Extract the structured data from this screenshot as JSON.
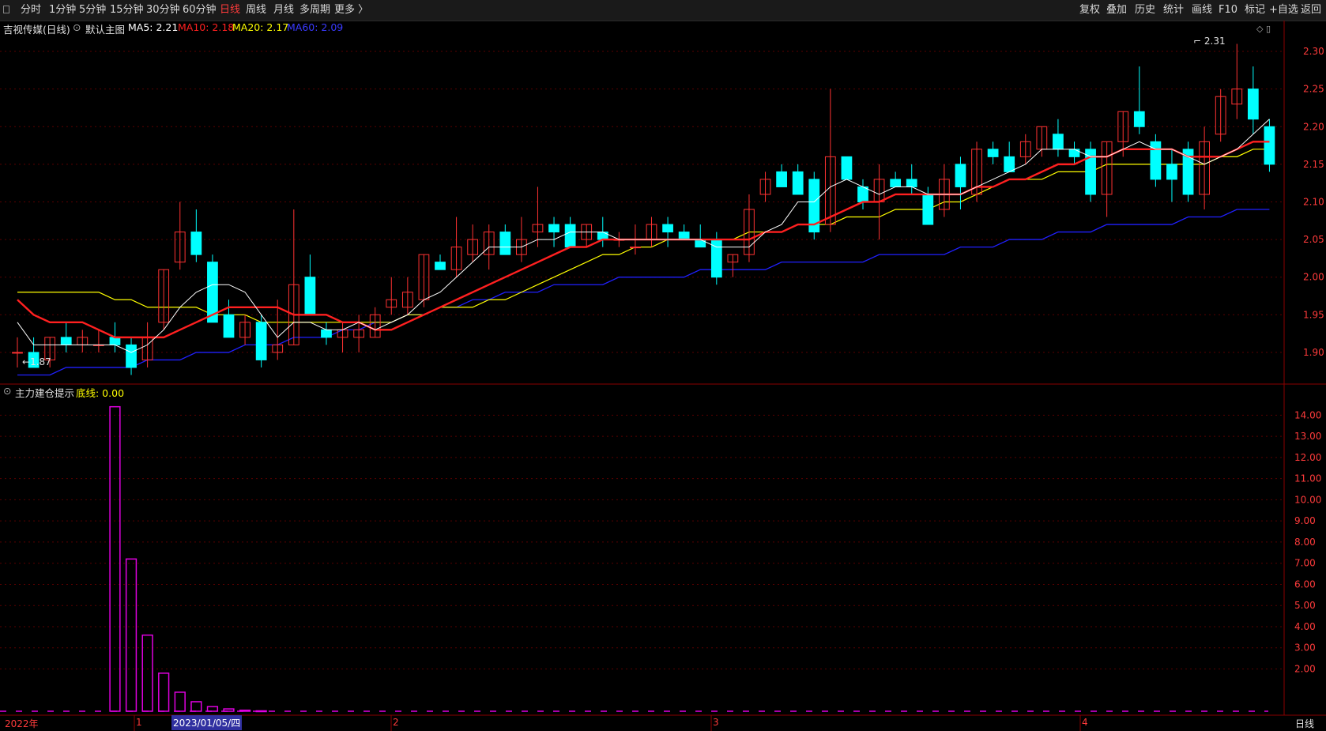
{
  "toolbar": {
    "periods": [
      "分时",
      "1分钟",
      "5分钟",
      "15分钟",
      "30分钟",
      "60分钟",
      "日线",
      "周线",
      "月线",
      "多周期",
      "更多 〉"
    ],
    "active_period": "日线",
    "right_buttons": [
      "复权",
      "叠加",
      "历史",
      "统计",
      "画线",
      "F10",
      "标记",
      "+自选",
      "返回"
    ]
  },
  "main_info": {
    "stock": "吉视传媒(日线)",
    "template": "默认主图",
    "ma5": "MA5: 2.21",
    "ma10": "MA10: 2.18",
    "ma20": "MA20: 2.17",
    "ma60": "MA60: 2.09"
  },
  "indicator_info": {
    "name": "主力建仓提示",
    "line": "底线: 0.00"
  },
  "bottom": {
    "year_label": "2022年",
    "months": [
      "1",
      "2",
      "3",
      "4"
    ],
    "date_cursor": "2023/01/05/四",
    "period": "日线"
  },
  "annotations": {
    "low": "1.87",
    "high": "2.31"
  },
  "colors": {
    "bg": "#000000",
    "up": "#ff3232",
    "down": "#00ffff",
    "ma5": "#ffffff",
    "ma10": "#ff2020",
    "ma20": "#ffff00",
    "ma60": "#2020ff",
    "grid": "#5a0000",
    "indicator": "#e000e0"
  },
  "chart_data": [
    {
      "type": "candlestick",
      "title": "吉视传媒(日线)",
      "ylim": [
        1.86,
        2.32
      ],
      "y_ticks": [
        1.9,
        1.95,
        2.0,
        2.05,
        2.1,
        2.15,
        2.2,
        2.25,
        2.3
      ],
      "candles": [
        [
          1.9,
          1.92,
          1.88,
          1.9
        ],
        [
          1.9,
          1.92,
          1.88,
          1.88
        ],
        [
          1.89,
          1.92,
          1.88,
          1.92
        ],
        [
          1.92,
          1.94,
          1.9,
          1.91
        ],
        [
          1.91,
          1.93,
          1.9,
          1.92
        ],
        [
          1.91,
          1.93,
          1.9,
          1.91
        ],
        [
          1.92,
          1.94,
          1.9,
          1.91
        ],
        [
          1.91,
          1.92,
          1.87,
          1.88
        ],
        [
          1.89,
          1.94,
          1.88,
          1.92
        ],
        [
          1.94,
          2.01,
          1.93,
          2.01
        ],
        [
          2.02,
          2.1,
          2.01,
          2.06
        ],
        [
          2.06,
          2.09,
          2.02,
          2.03
        ],
        [
          2.02,
          2.03,
          1.94,
          1.94
        ],
        [
          1.95,
          1.97,
          1.92,
          1.92
        ],
        [
          1.92,
          1.95,
          1.91,
          1.94
        ],
        [
          1.94,
          1.95,
          1.88,
          1.89
        ],
        [
          1.9,
          1.97,
          1.89,
          1.91
        ],
        [
          1.91,
          2.09,
          1.91,
          1.99
        ],
        [
          2.0,
          2.03,
          1.95,
          1.95
        ],
        [
          1.93,
          1.94,
          1.91,
          1.92
        ],
        [
          1.92,
          1.94,
          1.9,
          1.93
        ],
        [
          1.92,
          1.95,
          1.9,
          1.93
        ],
        [
          1.92,
          1.96,
          1.92,
          1.95
        ],
        [
          1.96,
          2.0,
          1.95,
          1.97
        ],
        [
          1.96,
          2.0,
          1.95,
          1.98
        ],
        [
          1.97,
          2.03,
          1.96,
          2.03
        ],
        [
          2.02,
          2.03,
          2.01,
          2.01
        ],
        [
          2.01,
          2.08,
          2.0,
          2.04
        ],
        [
          2.03,
          2.07,
          2.02,
          2.05
        ],
        [
          2.03,
          2.07,
          2.01,
          2.06
        ],
        [
          2.06,
          2.07,
          2.03,
          2.03
        ],
        [
          2.03,
          2.08,
          2.02,
          2.05
        ],
        [
          2.06,
          2.12,
          2.04,
          2.07
        ],
        [
          2.07,
          2.08,
          2.04,
          2.06
        ],
        [
          2.07,
          2.08,
          2.04,
          2.04
        ],
        [
          2.05,
          2.07,
          2.04,
          2.07
        ],
        [
          2.06,
          2.08,
          2.04,
          2.05
        ],
        [
          2.05,
          2.06,
          2.04,
          2.05
        ],
        [
          2.04,
          2.07,
          2.03,
          2.04
        ],
        [
          2.05,
          2.08,
          2.04,
          2.07
        ],
        [
          2.07,
          2.08,
          2.04,
          2.06
        ],
        [
          2.06,
          2.07,
          2.05,
          2.05
        ],
        [
          2.05,
          2.07,
          2.04,
          2.04
        ],
        [
          2.05,
          2.06,
          1.99,
          2.0
        ],
        [
          2.02,
          2.03,
          2.0,
          2.03
        ],
        [
          2.03,
          2.11,
          2.02,
          2.09
        ],
        [
          2.11,
          2.14,
          2.1,
          2.13
        ],
        [
          2.14,
          2.15,
          2.12,
          2.12
        ],
        [
          2.14,
          2.15,
          2.11,
          2.11
        ],
        [
          2.13,
          2.14,
          2.05,
          2.06
        ],
        [
          2.07,
          2.25,
          2.06,
          2.16
        ],
        [
          2.16,
          2.16,
          2.13,
          2.13
        ],
        [
          2.12,
          2.13,
          2.09,
          2.1
        ],
        [
          2.1,
          2.15,
          2.05,
          2.13
        ],
        [
          2.13,
          2.14,
          2.12,
          2.12
        ],
        [
          2.13,
          2.15,
          2.11,
          2.12
        ],
        [
          2.11,
          2.12,
          2.07,
          2.07
        ],
        [
          2.09,
          2.15,
          2.08,
          2.13
        ],
        [
          2.15,
          2.16,
          2.09,
          2.12
        ],
        [
          2.11,
          2.18,
          2.1,
          2.17
        ],
        [
          2.17,
          2.18,
          2.15,
          2.16
        ],
        [
          2.16,
          2.18,
          2.14,
          2.14
        ],
        [
          2.16,
          2.19,
          2.15,
          2.18
        ],
        [
          2.17,
          2.2,
          2.16,
          2.2
        ],
        [
          2.19,
          2.21,
          2.16,
          2.17
        ],
        [
          2.17,
          2.18,
          2.15,
          2.16
        ],
        [
          2.17,
          2.18,
          2.1,
          2.11
        ],
        [
          2.11,
          2.18,
          2.08,
          2.18
        ],
        [
          2.18,
          2.22,
          2.16,
          2.22
        ],
        [
          2.22,
          2.28,
          2.19,
          2.2
        ],
        [
          2.18,
          2.19,
          2.12,
          2.13
        ],
        [
          2.15,
          2.17,
          2.1,
          2.13
        ],
        [
          2.17,
          2.18,
          2.1,
          2.11
        ],
        [
          2.11,
          2.2,
          2.09,
          2.18
        ],
        [
          2.19,
          2.25,
          2.18,
          2.24
        ],
        [
          2.23,
          2.31,
          2.21,
          2.25
        ],
        [
          2.25,
          2.28,
          2.19,
          2.21
        ],
        [
          2.2,
          2.21,
          2.14,
          2.15
        ]
      ],
      "ma5": [
        1.94,
        1.91,
        1.91,
        1.91,
        1.91,
        1.91,
        1.91,
        1.9,
        1.91,
        1.93,
        1.96,
        1.98,
        1.99,
        1.99,
        1.98,
        1.95,
        1.92,
        1.94,
        1.94,
        1.93,
        1.93,
        1.94,
        1.93,
        1.94,
        1.95,
        1.97,
        1.98,
        2.0,
        2.02,
        2.04,
        2.04,
        2.04,
        2.05,
        2.05,
        2.06,
        2.06,
        2.06,
        2.05,
        2.05,
        2.05,
        2.05,
        2.05,
        2.05,
        2.04,
        2.04,
        2.04,
        2.06,
        2.07,
        2.1,
        2.1,
        2.12,
        2.13,
        2.12,
        2.11,
        2.12,
        2.12,
        2.11,
        2.11,
        2.11,
        2.12,
        2.13,
        2.14,
        2.15,
        2.17,
        2.17,
        2.17,
        2.16,
        2.16,
        2.17,
        2.18,
        2.17,
        2.17,
        2.16,
        2.15,
        2.16,
        2.17,
        2.19,
        2.21
      ],
      "ma10": [
        1.97,
        1.95,
        1.94,
        1.94,
        1.94,
        1.93,
        1.92,
        1.92,
        1.92,
        1.92,
        1.93,
        1.94,
        1.95,
        1.96,
        1.96,
        1.96,
        1.96,
        1.95,
        1.95,
        1.95,
        1.94,
        1.94,
        1.93,
        1.93,
        1.94,
        1.95,
        1.96,
        1.97,
        1.98,
        1.99,
        2.0,
        2.01,
        2.02,
        2.03,
        2.04,
        2.04,
        2.05,
        2.05,
        2.05,
        2.05,
        2.05,
        2.05,
        2.05,
        2.05,
        2.05,
        2.05,
        2.06,
        2.06,
        2.07,
        2.07,
        2.08,
        2.09,
        2.1,
        2.1,
        2.11,
        2.11,
        2.11,
        2.11,
        2.11,
        2.12,
        2.12,
        2.13,
        2.13,
        2.14,
        2.15,
        2.15,
        2.16,
        2.16,
        2.17,
        2.17,
        2.17,
        2.17,
        2.16,
        2.16,
        2.16,
        2.17,
        2.18,
        2.18
      ],
      "ma20": [
        1.98,
        1.98,
        1.98,
        1.98,
        1.98,
        1.98,
        1.97,
        1.97,
        1.96,
        1.96,
        1.96,
        1.96,
        1.95,
        1.95,
        1.95,
        1.94,
        1.94,
        1.94,
        1.94,
        1.94,
        1.94,
        1.94,
        1.94,
        1.94,
        1.95,
        1.95,
        1.96,
        1.96,
        1.96,
        1.97,
        1.97,
        1.98,
        1.99,
        2.0,
        2.01,
        2.02,
        2.03,
        2.03,
        2.04,
        2.04,
        2.05,
        2.05,
        2.05,
        2.05,
        2.05,
        2.06,
        2.06,
        2.06,
        2.07,
        2.07,
        2.07,
        2.08,
        2.08,
        2.08,
        2.09,
        2.09,
        2.09,
        2.1,
        2.1,
        2.11,
        2.12,
        2.13,
        2.13,
        2.13,
        2.14,
        2.14,
        2.14,
        2.15,
        2.15,
        2.15,
        2.15,
        2.15,
        2.15,
        2.15,
        2.16,
        2.16,
        2.17,
        2.17
      ],
      "ma60": [
        1.87,
        1.87,
        1.87,
        1.88,
        1.88,
        1.88,
        1.88,
        1.88,
        1.89,
        1.89,
        1.89,
        1.9,
        1.9,
        1.9,
        1.91,
        1.91,
        1.91,
        1.92,
        1.92,
        1.92,
        1.93,
        1.93,
        1.94,
        1.94,
        1.95,
        1.95,
        1.96,
        1.96,
        1.97,
        1.97,
        1.98,
        1.98,
        1.98,
        1.99,
        1.99,
        1.99,
        1.99,
        2.0,
        2.0,
        2.0,
        2.0,
        2.0,
        2.01,
        2.01,
        2.01,
        2.01,
        2.01,
        2.02,
        2.02,
        2.02,
        2.02,
        2.02,
        2.02,
        2.03,
        2.03,
        2.03,
        2.03,
        2.03,
        2.04,
        2.04,
        2.04,
        2.05,
        2.05,
        2.05,
        2.06,
        2.06,
        2.06,
        2.07,
        2.07,
        2.07,
        2.07,
        2.07,
        2.08,
        2.08,
        2.08,
        2.09,
        2.09,
        2.09
      ]
    },
    {
      "type": "bar",
      "title": "主力建仓提示",
      "ylim": [
        0,
        14.5
      ],
      "y_ticks": [
        2,
        3,
        4,
        5,
        6,
        7,
        8,
        9,
        10,
        11,
        12,
        13,
        14
      ],
      "y_tick_labels": [
        "2.00",
        "3.00",
        "4.00",
        "5.00",
        "6.00",
        "7.00",
        "8.00",
        "9.00",
        "10.00",
        "11.00",
        "12.00",
        "13.00",
        "14.00"
      ],
      "values": [
        0,
        0,
        0,
        0,
        0,
        0,
        14.4,
        7.2,
        3.6,
        1.8,
        0.9,
        0.45,
        0.22,
        0.11,
        0.05,
        0.02,
        0,
        0,
        0,
        0,
        0,
        0,
        0,
        0,
        0,
        0,
        0,
        0,
        0,
        0,
        0,
        0,
        0,
        0,
        0,
        0,
        0,
        0,
        0,
        0,
        0,
        0,
        0,
        0,
        0,
        0,
        0,
        0,
        0,
        0,
        0,
        0,
        0,
        0,
        0,
        0,
        0,
        0,
        0,
        0,
        0,
        0,
        0,
        0,
        0,
        0,
        0,
        0,
        0,
        0,
        0,
        0,
        0,
        0,
        0,
        0,
        0,
        0
      ],
      "baseline": 0.0
    }
  ]
}
